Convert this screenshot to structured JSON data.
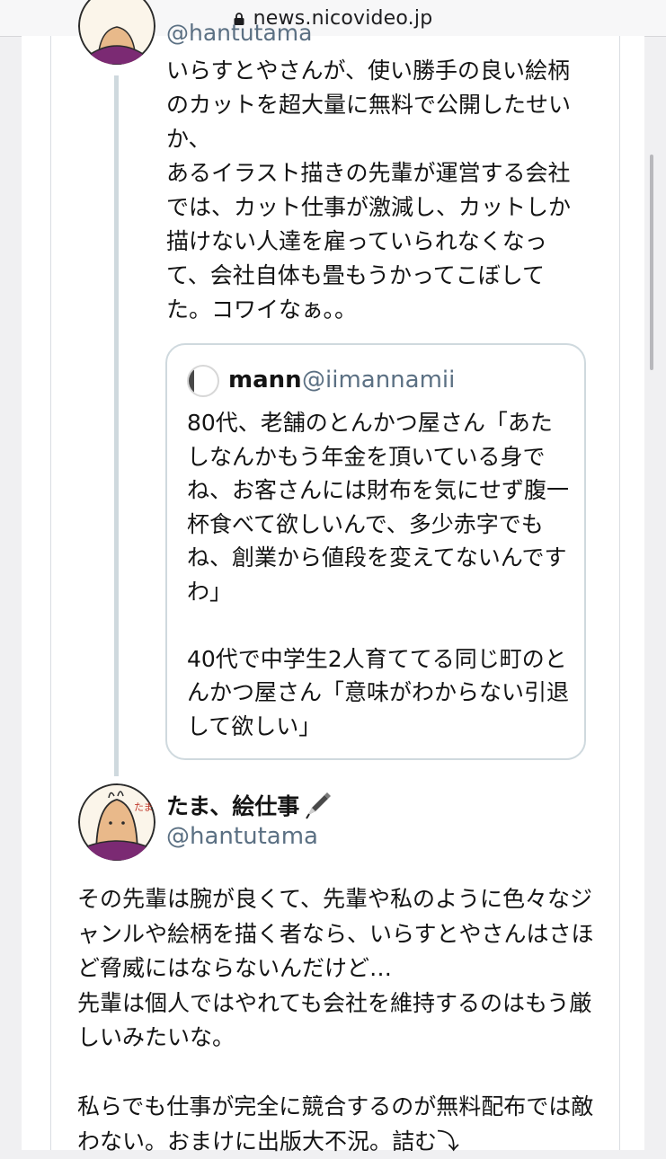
{
  "browser": {
    "url": "news.nicovideo.jp",
    "lock_icon": "lock-icon"
  },
  "tweet1": {
    "handle": "@hantutama",
    "text": "いらすとやさんが、使い勝手の良い絵柄のカットを超大量に無料で公開したせいか、\nあるイラスト描きの先輩が運営する会社では、カット仕事が激減し、カットしか描けない人達を雇っていられなくなって、会社自体も畳もうかってこぼしてた。コワイなぁ。。"
  },
  "quote": {
    "name": "mann",
    "handle": "@iimannamii",
    "text": "80代、老舗のとんかつ屋さん「あたしなんかもう年金を頂いている身でね、お客さんには財布を気にせず腹一杯食べて欲しいんで、多少赤字でもね、創業から値段を変えてないんですわ」\n\n40代で中学生2人育ててる同じ町のとんかつ屋さん「意味がわからない引退して欲しい」"
  },
  "tweet2": {
    "name": "たま、絵仕事",
    "name_icon": "pen-icon",
    "handle": "@hantutama",
    "text": "その先輩は腕が良くて、先輩や私のように色々なジャンルや絵柄を描く者なら、いらすとやさんはさほど脅威にはならないんだけど…\n先輩は個人ではやれても会社を維持するのはもう厳しいみたいな。\n\n私らでも仕事が完全に競合するのが無料配布では敵わない。おまけに出版大不況。詰む⤵"
  },
  "avatar_label": "たま"
}
